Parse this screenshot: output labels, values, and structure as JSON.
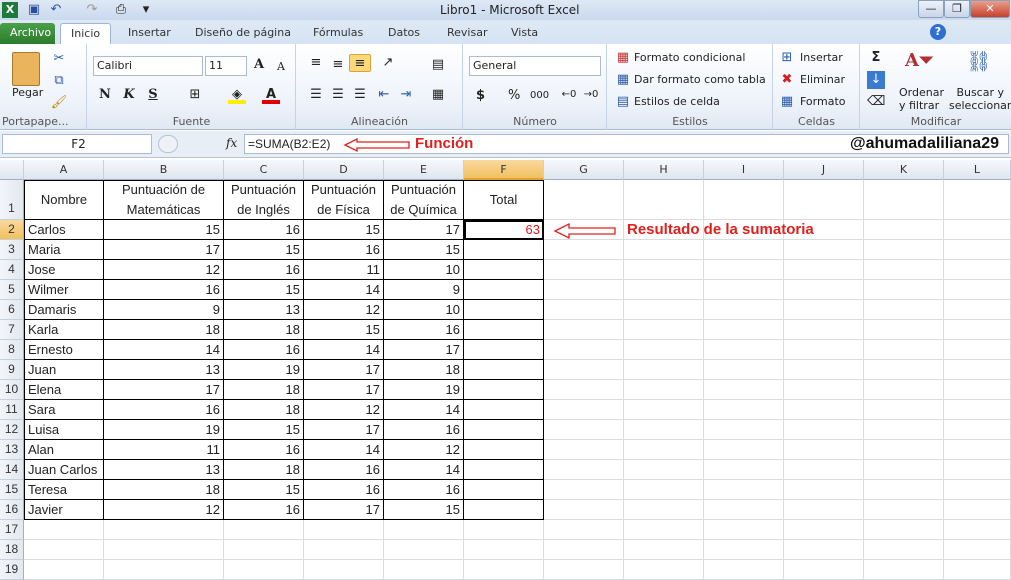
{
  "window": {
    "title": "Libro1  -  Microsoft Excel",
    "minimize": "—",
    "restore": "❐",
    "close": "✕"
  },
  "quick_access": {
    "save": "💾",
    "undo": "↶",
    "redo": "↷",
    "print_preview": "🔍",
    "customize": "▾"
  },
  "tabs": [
    "Archivo",
    "Inicio",
    "Insertar",
    "Diseño de página",
    "Fórmulas",
    "Datos",
    "Revisar",
    "Vista"
  ],
  "ribbon": {
    "clipboard": {
      "paste": "Pegar",
      "label": "Portapape..."
    },
    "font": {
      "name": "Calibri",
      "size": "11",
      "bold": "N",
      "italic": "K",
      "underline": "S",
      "label": "Fuente"
    },
    "alignment": {
      "label": "Alineación"
    },
    "number": {
      "format": "General",
      "currency": "$",
      "percent": "%",
      "thousands": "000",
      "label": "Número"
    },
    "styles": {
      "conditional": "Formato condicional",
      "as_table": "Dar formato como tabla",
      "cell_styles": "Estilos de celda",
      "label": "Estilos"
    },
    "cells": {
      "insert": "Insertar",
      "delete": "Eliminar",
      "format": "Formato",
      "label": "Celdas"
    },
    "editing": {
      "sum": "Σ",
      "sort_l1": "Ordenar",
      "sort_l2": "y filtrar",
      "find_l1": "Buscar y",
      "find_l2": "seleccionar",
      "label": "Modificar"
    }
  },
  "formula_bar": {
    "name_box": "F2",
    "fx": "fx",
    "formula": "=SUMA(B2:E2)"
  },
  "annotations": {
    "function": "Función",
    "result": "Resultado de la sumatoria",
    "author": "@ahumadaliliana29"
  },
  "columns": [
    "A",
    "B",
    "C",
    "D",
    "E",
    "F",
    "G",
    "H",
    "I",
    "J",
    "K",
    "L"
  ],
  "headers": [
    "Nombre",
    "Puntuación de Matemáticas",
    "Puntuación de Inglés",
    "Puntuación de Física",
    "Puntuación de Química",
    "Total"
  ],
  "rows": [
    [
      "Carlos",
      15,
      16,
      15,
      17,
      63
    ],
    [
      "Maria",
      17,
      15,
      16,
      15,
      ""
    ],
    [
      "Jose",
      12,
      16,
      11,
      10,
      ""
    ],
    [
      "Wilmer",
      16,
      15,
      14,
      9,
      ""
    ],
    [
      "Damaris",
      9,
      13,
      12,
      10,
      ""
    ],
    [
      "Karla",
      18,
      18,
      15,
      16,
      ""
    ],
    [
      "Ernesto",
      14,
      16,
      14,
      17,
      ""
    ],
    [
      "Juan",
      13,
      19,
      17,
      18,
      ""
    ],
    [
      "Elena",
      17,
      18,
      17,
      19,
      ""
    ],
    [
      "Sara",
      16,
      18,
      12,
      14,
      ""
    ],
    [
      "Luisa",
      19,
      15,
      17,
      16,
      ""
    ],
    [
      "Alan",
      11,
      16,
      14,
      12,
      ""
    ],
    [
      "Juan Carlos",
      13,
      18,
      16,
      14,
      ""
    ],
    [
      "Teresa",
      18,
      15,
      16,
      16,
      ""
    ],
    [
      "Javier",
      12,
      16,
      17,
      15,
      ""
    ]
  ],
  "colors": {
    "accent": "#e0201c",
    "selected": "#f1c15f"
  }
}
